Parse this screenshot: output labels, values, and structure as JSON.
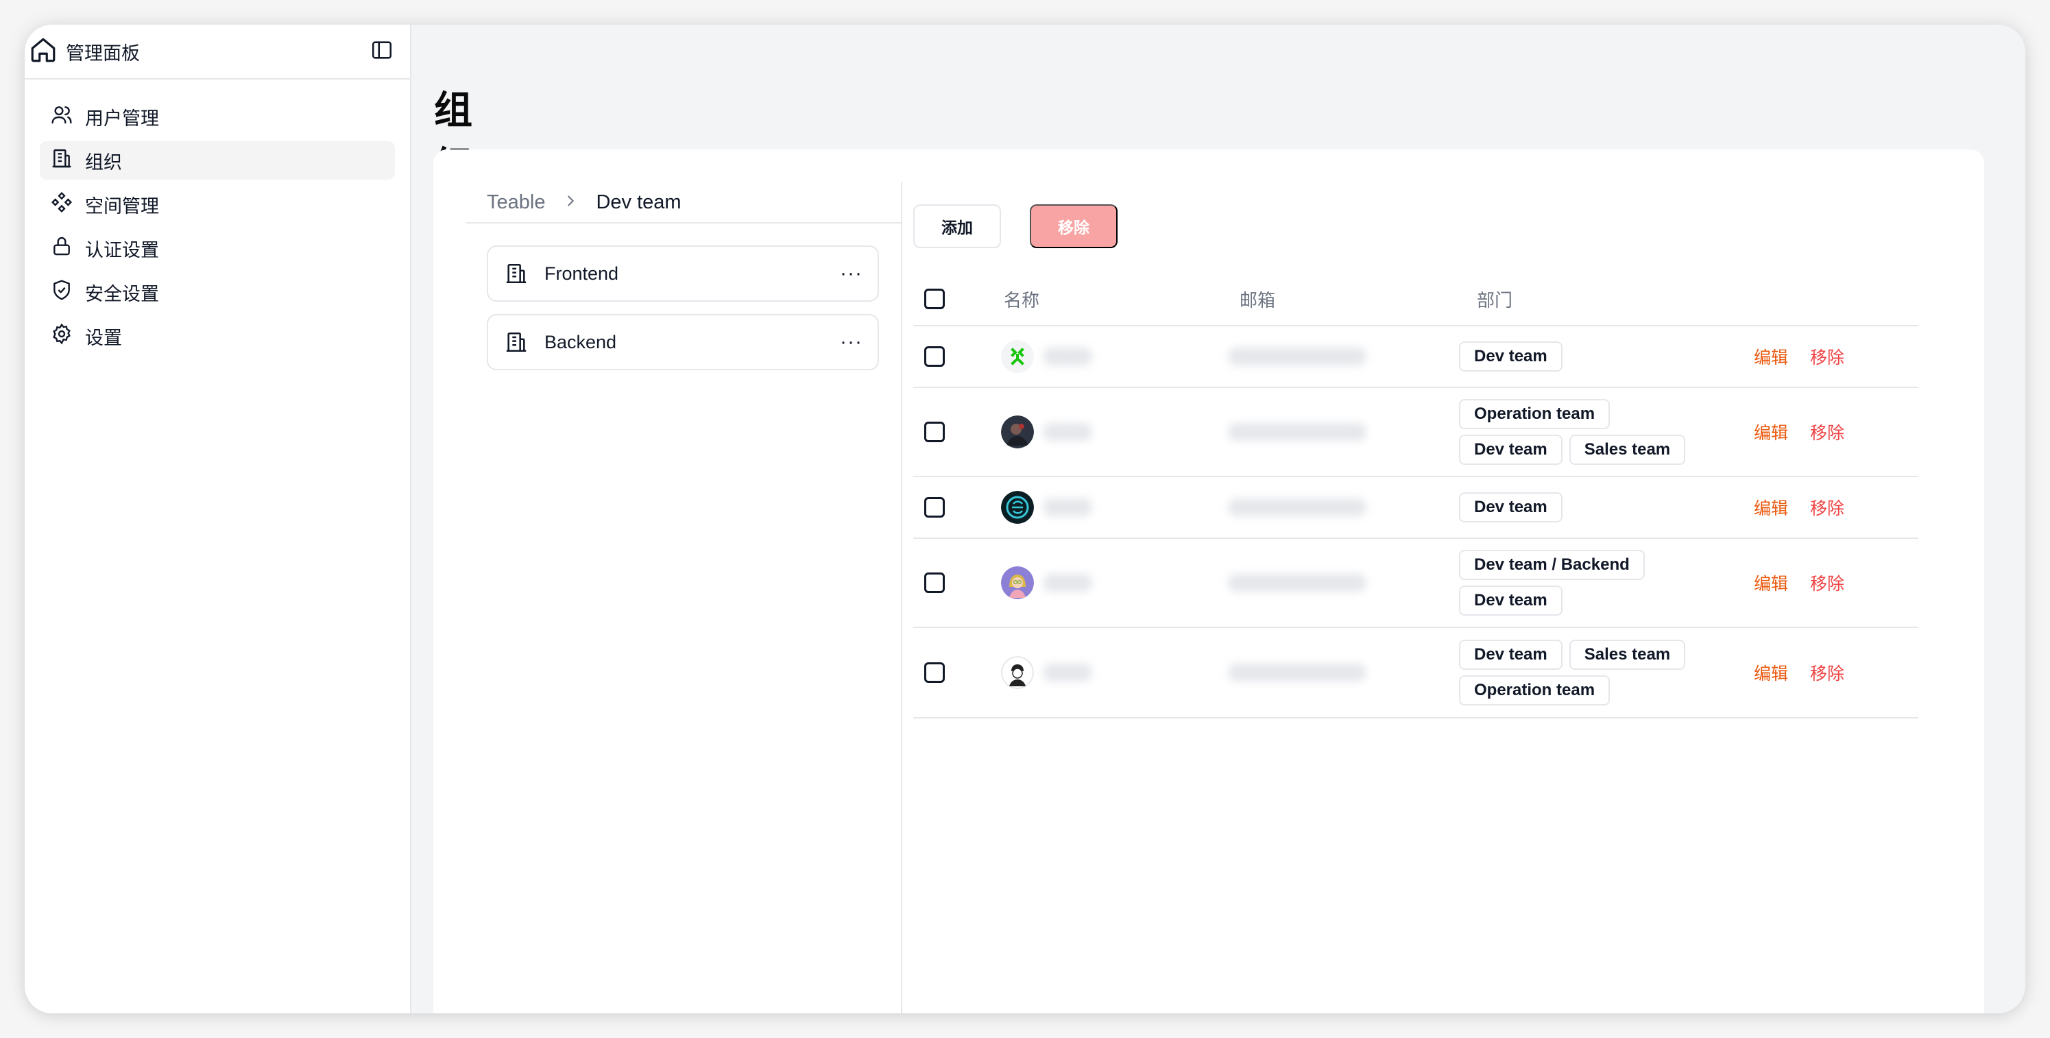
{
  "sidebar": {
    "title": "管理面板",
    "items": [
      {
        "label": "用户管理",
        "icon": "users-icon"
      },
      {
        "label": "组织",
        "icon": "building-icon",
        "active": true
      },
      {
        "label": "空间管理",
        "icon": "component-icon"
      },
      {
        "label": "认证设置",
        "icon": "lock-icon"
      },
      {
        "label": "安全设置",
        "icon": "shield-icon"
      },
      {
        "label": "设置",
        "icon": "gear-icon"
      }
    ]
  },
  "page": {
    "title": "组织管理"
  },
  "breadcrumb": {
    "root": "Teable",
    "current": "Dev team"
  },
  "departments": [
    {
      "name": "Frontend",
      "more": "···"
    },
    {
      "name": "Backend",
      "more": "···"
    }
  ],
  "toolbar": {
    "add_label": "添加",
    "remove_label": "移除"
  },
  "table": {
    "headers": {
      "name": "名称",
      "email": "邮箱",
      "department": "部门"
    },
    "rows": [
      {
        "tags": [
          [
            "Dev team"
          ]
        ],
        "edit": "编辑",
        "remove": "移除"
      },
      {
        "tags": [
          [
            "Operation team"
          ],
          [
            "Dev team",
            "Sales team"
          ]
        ],
        "edit": "编辑",
        "remove": "移除"
      },
      {
        "tags": [
          [
            "Dev team"
          ]
        ],
        "edit": "编辑",
        "remove": "移除"
      },
      {
        "tags": [
          [
            "Dev team / Backend"
          ],
          [
            "Dev team"
          ]
        ],
        "edit": "编辑",
        "remove": "移除"
      },
      {
        "tags": [
          [
            "Dev team",
            "Sales team"
          ],
          [
            "Operation team"
          ]
        ],
        "edit": "编辑",
        "remove": "移除"
      }
    ]
  },
  "colors": {
    "edit": "#ea580c",
    "remove": "#ef4444",
    "remove_button_bg": "#f8a4a4"
  }
}
